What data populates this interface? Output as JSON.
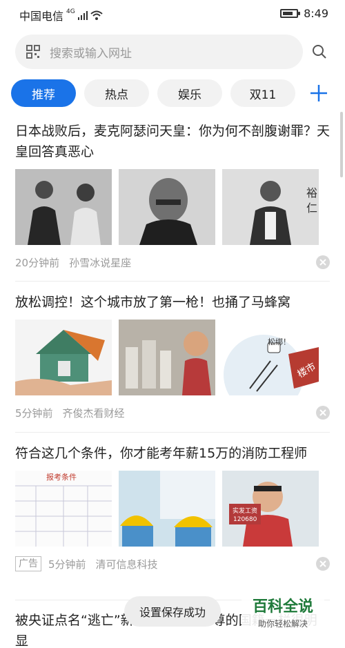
{
  "status_bar": {
    "carrier": "中国电信",
    "network": "4G",
    "time": "8:49",
    "battery_level": 0.75
  },
  "search": {
    "placeholder": "搜索或输入网址",
    "icons": [
      "qr-code-icon",
      "search-icon"
    ]
  },
  "tabs": [
    {
      "label": "推荐",
      "active": true
    },
    {
      "label": "热点",
      "active": false
    },
    {
      "label": "娱乐",
      "active": false
    },
    {
      "label": "双11",
      "active": false
    }
  ],
  "articles": [
    {
      "title": "日本战败后，麦克阿瑟问天皇：你为何不剖腹谢罪？天皇回答真恶心",
      "time": "20分钟前",
      "source": "孙雪冰说星座",
      "ad": ""
    },
    {
      "title": "放松调控！这个城市放了第一枪！也捅了马蜂窝",
      "time": "5分钟前",
      "source": "齐俊杰看财经",
      "ad": "",
      "cartoon_text": [
        "松绑！",
        "楼市"
      ]
    },
    {
      "title": "符合这几个条件，你才能考年薪15万的消防工程师",
      "time": "5分钟前",
      "source": "清可信息科技",
      "ad": "广告",
      "image_text": [
        "报考条件",
        "实发工资",
        "120680"
      ]
    },
    {
      "title": "被央证点名“逃亡”新加坡，是源本尊的国籍一栏很明显",
      "time": "",
      "source": "",
      "ad": ""
    }
  ],
  "toast": "设置保存成功",
  "watermark": {
    "title": "百科全说",
    "subtitle": "助你轻松解决"
  },
  "colors": {
    "accent": "#1a73e8",
    "background": "#ffffff",
    "muted_text": "#9a9a9a",
    "chip_bg": "#f2f2f2"
  }
}
